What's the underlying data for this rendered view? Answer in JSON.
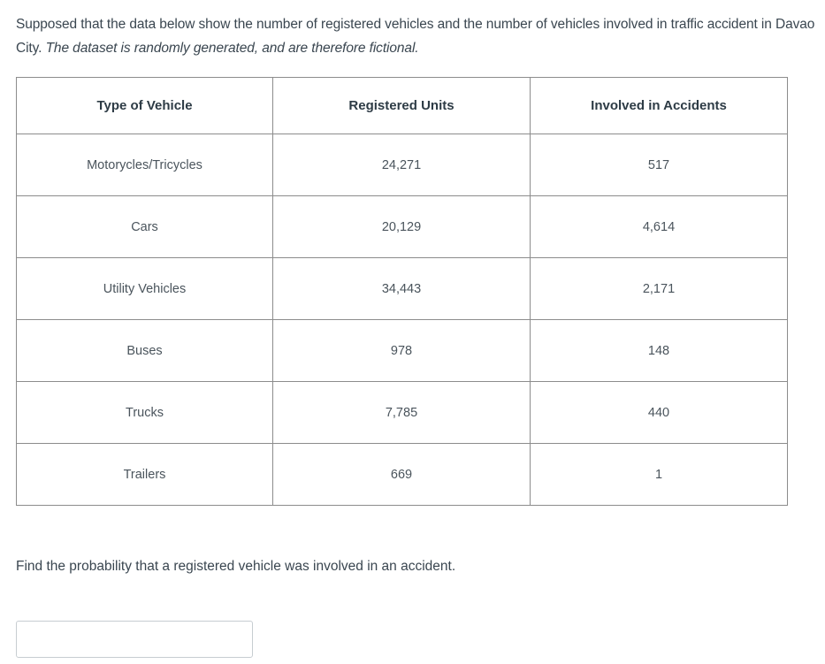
{
  "intro": {
    "text": "Supposed that the data below show the number of registered vehicles and the number of vehicles involved in traffic accident in Davao City. ",
    "italic_note": "The dataset is randomly generated, and are therefore fictional."
  },
  "table": {
    "headers": [
      "Type of Vehicle",
      "Registered Units",
      "Involved in Accidents"
    ],
    "rows": [
      [
        "Motorycles/Tricycles",
        "24,271",
        "517"
      ],
      [
        "Cars",
        "20,129",
        "4,614"
      ],
      [
        "Utility Vehicles",
        "34,443",
        "2,171"
      ],
      [
        "Buses",
        "978",
        "148"
      ],
      [
        "Trucks",
        "7,785",
        "440"
      ],
      [
        "Trailers",
        "669",
        "1"
      ]
    ]
  },
  "question": {
    "text": "Find the probability that a registered vehicle was involved in an accident.",
    "answer_value": "",
    "answer_placeholder": ""
  }
}
